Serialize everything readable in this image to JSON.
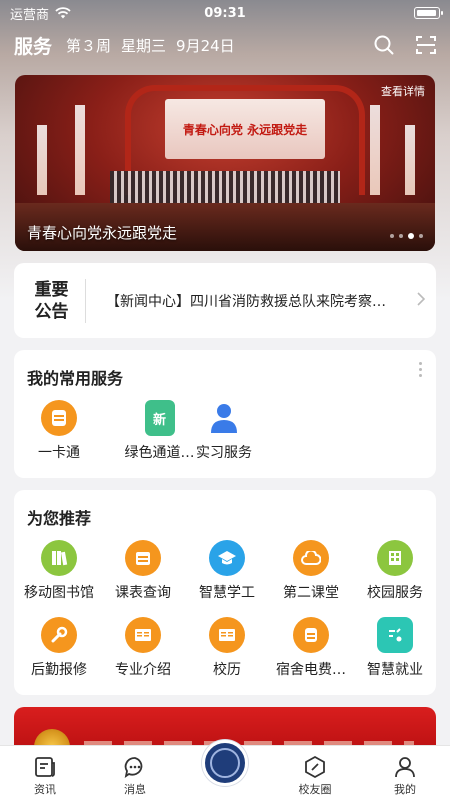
{
  "status": {
    "carrier": "运营商",
    "time": "09:31"
  },
  "header": {
    "title": "服务",
    "week": "第３周",
    "weekday": "星期三",
    "date": "9月24日"
  },
  "banner": {
    "more": "查看详情",
    "caption": "青春心向党永远跟党走",
    "screen_text": "青春心向党 永远跟党走",
    "slides": 4,
    "active_slide": 3
  },
  "notice": {
    "label_line1": "重要",
    "label_line2": "公告",
    "text": "【新闻中心】四川省消防救援总队来院考察…"
  },
  "services": {
    "title": "我的常用服务",
    "items": [
      {
        "label": "一卡通",
        "icon": "card-icon",
        "color": "#f5961e"
      },
      {
        "label": "绿色通道…",
        "icon": "green-channel-icon",
        "color": "#3fbf8a"
      },
      {
        "label": "实习服务",
        "icon": "intern-icon",
        "color": "#3a7be8"
      }
    ]
  },
  "recommend": {
    "title": "为您推荐",
    "items": [
      {
        "label": "移动图书馆",
        "icon": "library-icon",
        "color": "#8cc63f"
      },
      {
        "label": "课表查询",
        "icon": "timetable-icon",
        "color": "#f5961e"
      },
      {
        "label": "智慧学工",
        "icon": "graduation-cap-icon",
        "color": "#2aa3e8"
      },
      {
        "label": "第二课堂",
        "icon": "cloud-icon",
        "color": "#f5961e"
      },
      {
        "label": "校园服务",
        "icon": "building-icon",
        "color": "#8cc63f"
      },
      {
        "label": "后勤报修",
        "icon": "wrench-icon",
        "color": "#f5961e"
      },
      {
        "label": "专业介绍",
        "icon": "book-icon",
        "color": "#f5961e"
      },
      {
        "label": "校历",
        "icon": "calendar-book-icon",
        "color": "#f5961e"
      },
      {
        "label": "宿舍电费…",
        "icon": "electric-icon",
        "color": "#f5961e"
      },
      {
        "label": "智慧就业",
        "icon": "job-icon",
        "color": "#2cc6b4"
      }
    ]
  },
  "tabbar": {
    "items": [
      {
        "label": "资讯",
        "icon": "news-icon"
      },
      {
        "label": "消息",
        "icon": "message-icon"
      },
      {
        "label": "",
        "icon": "school-emblem-icon"
      },
      {
        "label": "校友圈",
        "icon": "compass-icon"
      },
      {
        "label": "我的",
        "icon": "profile-icon"
      }
    ]
  }
}
